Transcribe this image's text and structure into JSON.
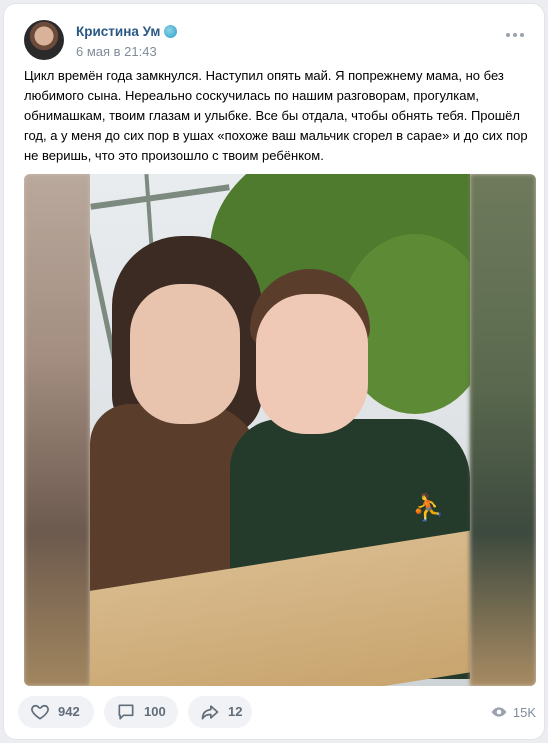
{
  "post": {
    "author": "Кристина Ум",
    "date": "6 мая в 21:43",
    "text": "Цикл времён года замкнулся. Наступил опять май. Я попрежнему мама, но без любимого сына. Нереально соскучилась по нашим разговорам, прогулкам, обнимашкам, твоим глазам и улыбке. Все бы отдала, чтобы обнять тебя. Прошёл год, а у меня до сих пор в ушах «похоже ваш мальчик сгорел в сарае» и до сих пор не веришь, что это произошло с твоим ребёнком."
  },
  "actions": {
    "likes": "942",
    "comments": "100",
    "shares": "12",
    "views": "15K"
  },
  "icons": {
    "like": "heart-icon",
    "comment": "comment-icon",
    "share": "share-icon",
    "views": "eye-icon",
    "more": "more-dots-icon",
    "verified": "verified-badge-icon"
  },
  "colors": {
    "author_link": "#2a5885",
    "meta": "#818c99",
    "pill_bg": "#f0f2f5"
  }
}
